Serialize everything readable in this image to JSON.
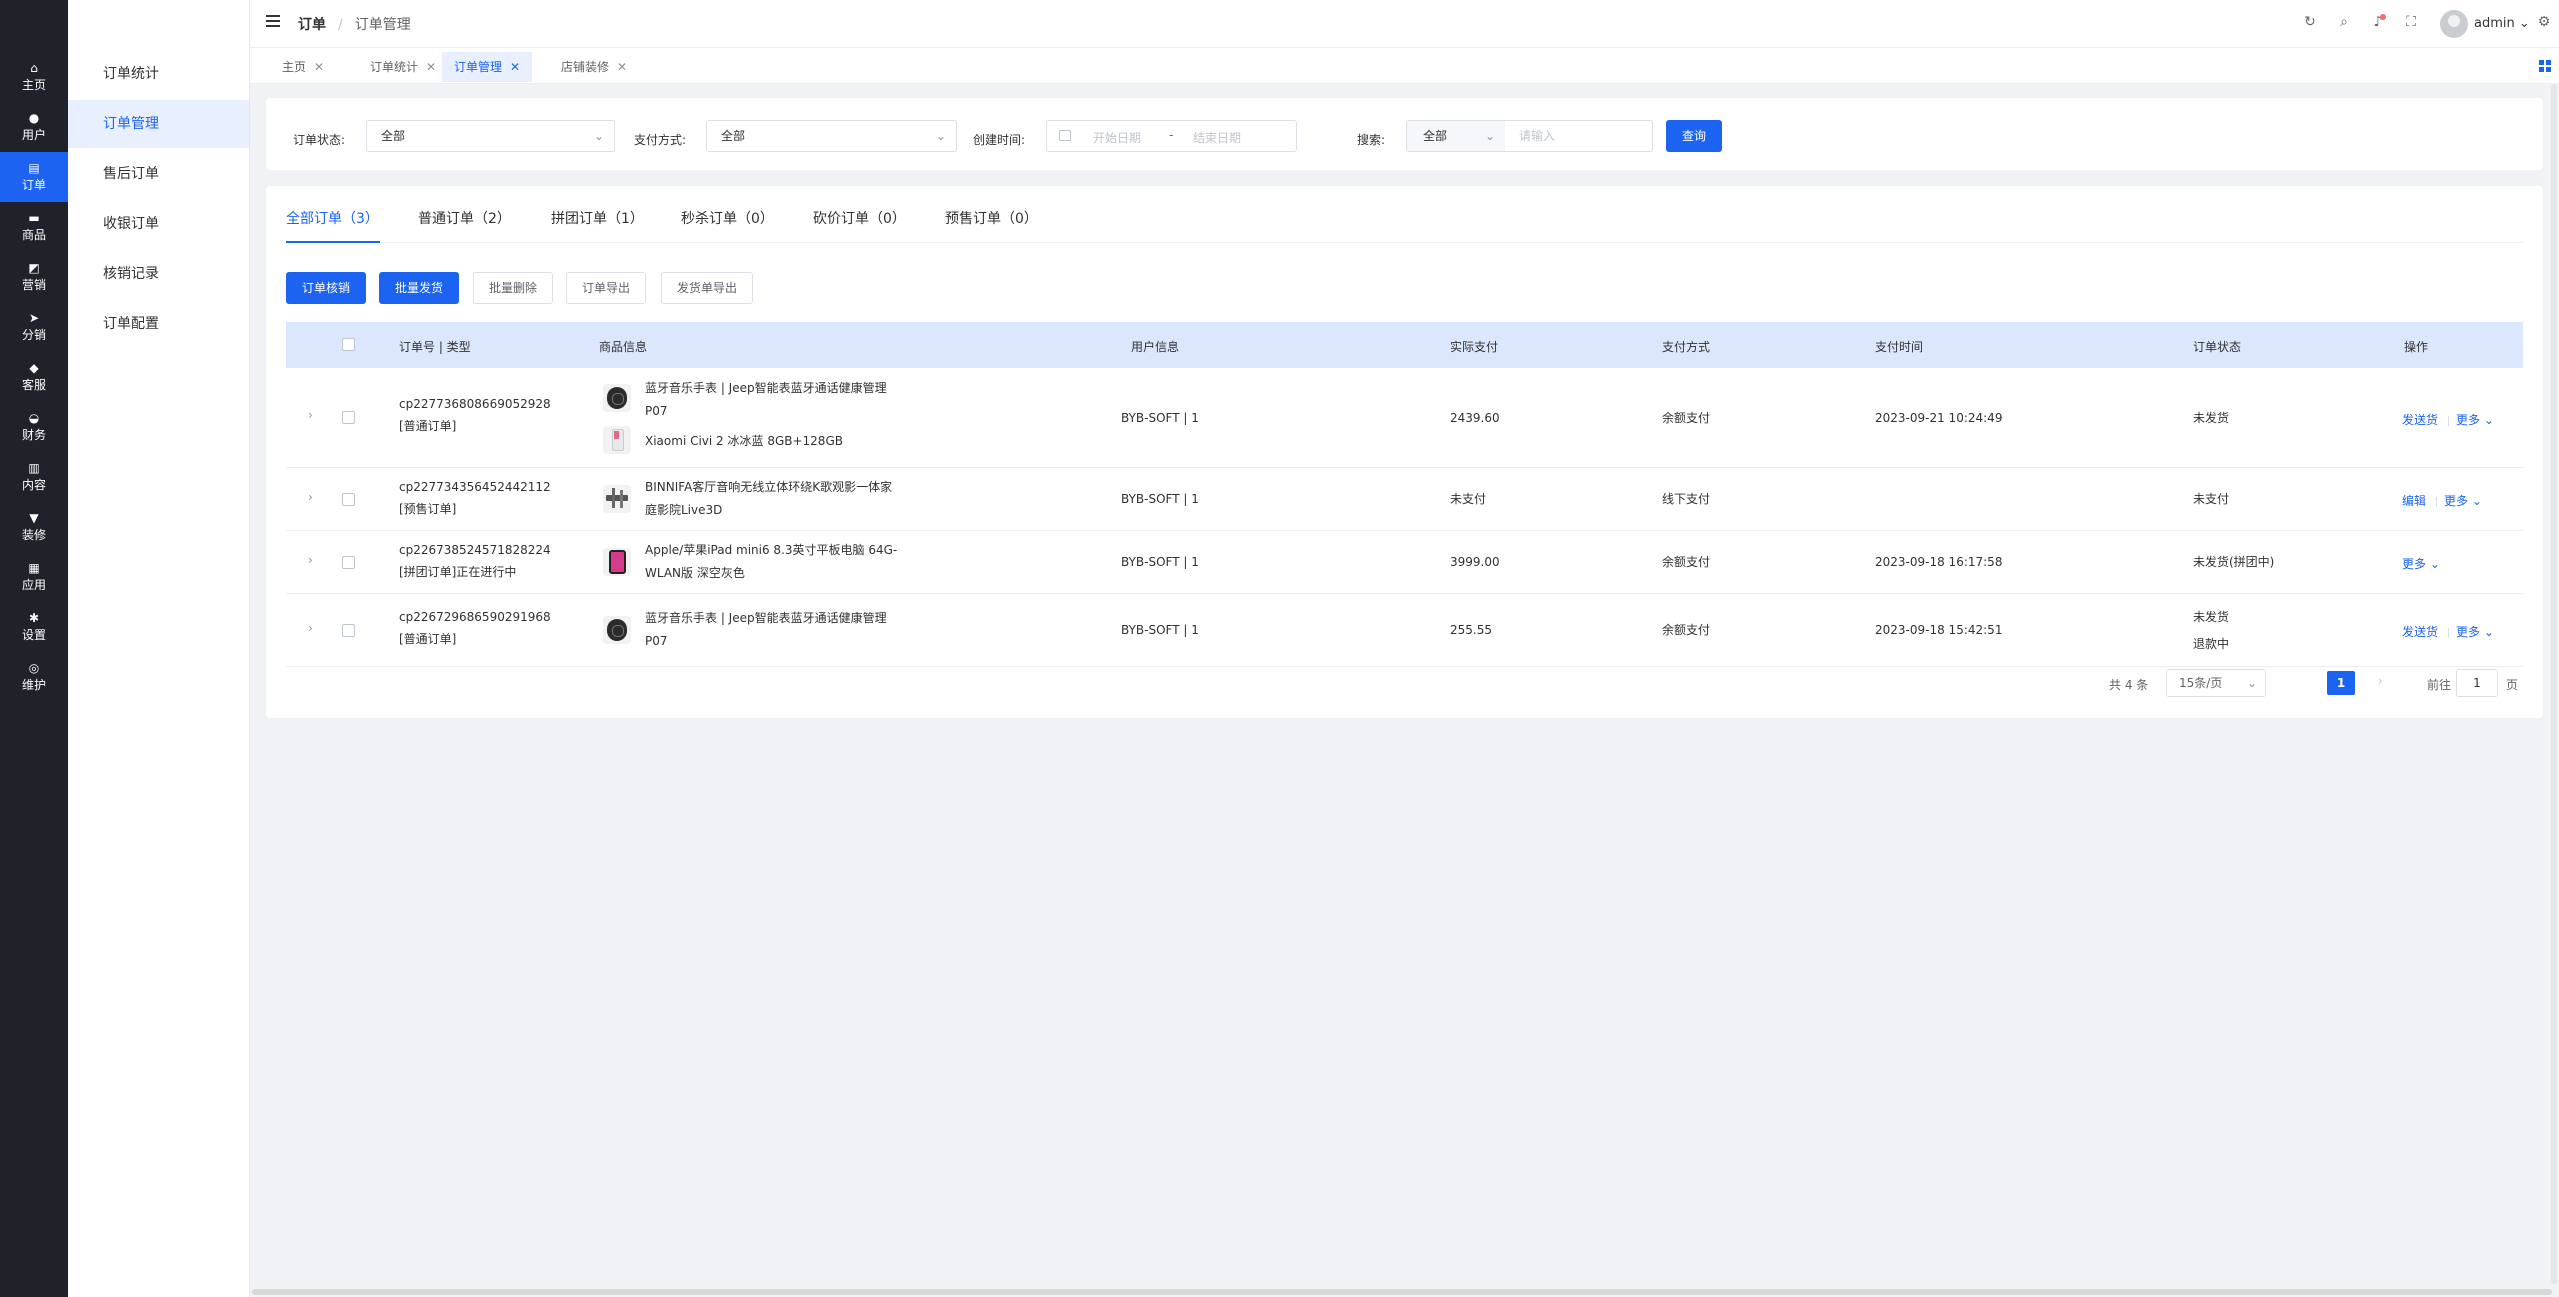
{
  "rail": {
    "items": [
      {
        "label": "主页",
        "icon": "home-icon",
        "glyph": "⌂"
      },
      {
        "label": "用户",
        "icon": "user-icon",
        "glyph": "●"
      },
      {
        "label": "订单",
        "icon": "order-icon",
        "glyph": "▤"
      },
      {
        "label": "商品",
        "icon": "product-icon",
        "glyph": "▬"
      },
      {
        "label": "营销",
        "icon": "marketing-icon",
        "glyph": "◩"
      },
      {
        "label": "分销",
        "icon": "distribution-icon",
        "glyph": "➤"
      },
      {
        "label": "客服",
        "icon": "service-icon",
        "glyph": "◆"
      },
      {
        "label": "财务",
        "icon": "finance-icon",
        "glyph": "◒"
      },
      {
        "label": "内容",
        "icon": "content-icon",
        "glyph": "▥"
      },
      {
        "label": "装修",
        "icon": "decorate-icon",
        "glyph": "▼"
      },
      {
        "label": "应用",
        "icon": "apps-icon",
        "glyph": "▦"
      },
      {
        "label": "设置",
        "icon": "settings-icon",
        "glyph": "✱"
      },
      {
        "label": "维护",
        "icon": "maintain-icon",
        "glyph": "◎"
      }
    ]
  },
  "subnav": {
    "items": [
      "订单统计",
      "订单管理",
      "售后订单",
      "收银订单",
      "核销记录",
      "订单配置"
    ]
  },
  "header": {
    "breadcrumb_parent": "订单",
    "breadcrumb_sep": "/",
    "breadcrumb_current": "订单管理",
    "username": "admin"
  },
  "page_tabs": [
    {
      "label": "主页"
    },
    {
      "label": "订单统计"
    },
    {
      "label": "订单管理"
    },
    {
      "label": "店铺装修"
    }
  ],
  "filters": {
    "status_label": "订单状态:",
    "status_value": "全部",
    "pay_label": "支付方式:",
    "pay_value": "全部",
    "created_label": "创建时间:",
    "start_placeholder": "开始日期",
    "range_sep": "-",
    "end_placeholder": "结束日期",
    "search_label": "搜索:",
    "search_type": "全部",
    "search_placeholder": "请输入",
    "query_button": "查询"
  },
  "order_tabs": [
    "全部订单（3）",
    "普通订单（2）",
    "拼团订单（1）",
    "秒杀订单（0）",
    "砍价订单（0）",
    "预售订单（0）"
  ],
  "actions": [
    "订单核销",
    "批量发货",
    "批量删除",
    "订单导出",
    "发货单导出"
  ],
  "table": {
    "headers": [
      "订单号 | 类型",
      "商品信息",
      "用户信息",
      "实际支付",
      "支付方式",
      "支付时间",
      "订单状态",
      "操作"
    ],
    "rows": [
      {
        "order_no": "cp227736808669052928",
        "type": "[普通订单]",
        "products": [
          {
            "line1": "蓝牙音乐手表 | Jeep智能表蓝牙通话健康管理",
            "line2": "P07"
          },
          {
            "line1": "Xiaomi Civi 2 冰冰蓝 8GB+128GB",
            "line2": ""
          }
        ],
        "user": "BYB-SOFT | 1",
        "paid": "2439.60",
        "pay_method": "余额支付",
        "pay_time": "2023-09-21 10:24:49",
        "status": "未发货",
        "status2": "",
        "op1": "发送货",
        "op2": "更多"
      },
      {
        "order_no": "cp227734356452442112",
        "type": "[预售订单]",
        "products": [
          {
            "line1": "BINNIFA客厅音响无线立体环绕K歌观影一体家",
            "line2": "庭影院Live3D"
          }
        ],
        "user": "BYB-SOFT | 1",
        "paid": "未支付",
        "pay_method": "线下支付",
        "pay_time": "",
        "status": "未支付",
        "status2": "",
        "op1": "编辑",
        "op2": "更多"
      },
      {
        "order_no": "cp226738524571828224",
        "type": "[拼团订单]正在进行中",
        "products": [
          {
            "line1": "Apple/苹果iPad mini6 8.3英寸平板电脑 64G-",
            "line2": "WLAN版 深空灰色"
          }
        ],
        "user": "BYB-SOFT | 1",
        "paid": "3999.00",
        "pay_method": "余额支付",
        "pay_time": "2023-09-18 16:17:58",
        "status": "未发货(拼团中)",
        "status2": "",
        "op1": "",
        "op2": "更多"
      },
      {
        "order_no": "cp226729686590291968",
        "type": "[普通订单]",
        "products": [
          {
            "line1": "蓝牙音乐手表 | Jeep智能表蓝牙通话健康管理",
            "line2": "P07"
          }
        ],
        "user": "BYB-SOFT | 1",
        "paid": "255.55",
        "pay_method": "余额支付",
        "pay_time": "2023-09-18 15:42:51",
        "status": "未发货",
        "status2": "退款中",
        "op1": "发送货",
        "op2": "更多"
      }
    ]
  },
  "pagination": {
    "total_text": "共 4 条",
    "page_size": "15条/页",
    "current_page": "1",
    "goto_label": "前往",
    "goto_value": "1",
    "page_suffix": "页"
  },
  "colors": {
    "accent": "#1c63f2",
    "rail": "#1f2329",
    "table_header": "#dbe7fc"
  }
}
